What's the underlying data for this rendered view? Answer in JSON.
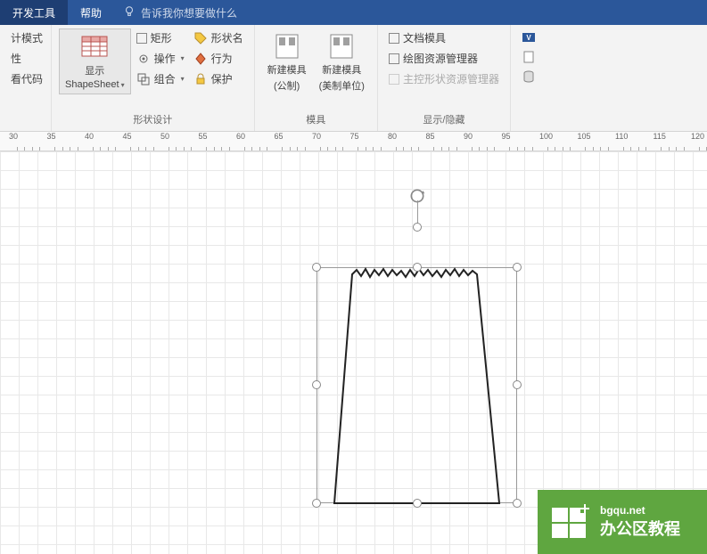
{
  "tabs": {
    "dev_tools": "开发工具",
    "help": "帮助",
    "tell_me": "告诉我你想要做什么"
  },
  "ribbon": {
    "group1": {
      "design_mode": "计模式",
      "properties": "性",
      "view_code": "看代码"
    },
    "shape_design": {
      "label": "形状设计",
      "show": "显示",
      "shapesheet": "ShapeSheet",
      "rect": "矩形",
      "operation": "操作",
      "combine": "组合",
      "shape_name": "形状名",
      "behavior": "行为",
      "protect": "保护"
    },
    "stencil": {
      "label": "模具",
      "new_metric": "新建模具",
      "metric_sub": "(公制)",
      "new_us": "新建模具",
      "us_sub": "(美制单位)"
    },
    "show_hide": {
      "label": "显示/隐藏",
      "doc_stencil": "文档模具",
      "drawing_explorer": "绘图资源管理器",
      "master_explorer": "主控形状资源管理器"
    }
  },
  "ruler_marks": [
    30,
    35,
    40,
    45,
    50,
    55,
    60,
    65,
    70,
    75,
    80,
    85,
    90,
    95,
    100,
    105,
    110,
    115,
    120
  ],
  "watermark": {
    "url": "bgqu.net",
    "name": "办公区教程"
  }
}
